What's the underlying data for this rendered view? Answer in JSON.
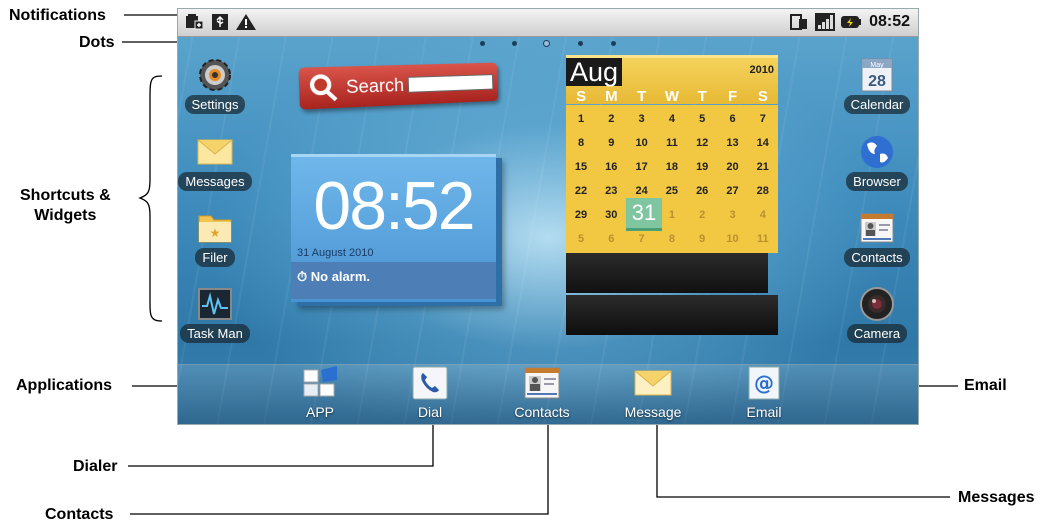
{
  "callouts": {
    "notifications": "Notifications",
    "dots": "Dots",
    "shortcuts_line1": "Shortcuts &",
    "shortcuts_line2": "Widgets",
    "applications": "Applications",
    "dialer": "Dialer",
    "contacts": "Contacts",
    "email": "Email",
    "messages": "Messages"
  },
  "statusbar": {
    "left_icons": [
      "sd-card-icon",
      "usb-icon",
      "warning-icon"
    ],
    "right_icons": [
      "screen-rotate-icon",
      "signal-icon",
      "battery-icon"
    ],
    "time": "08:52"
  },
  "home_dots": 5,
  "left_shortcuts": [
    {
      "label": "Settings",
      "icon": "gear-icon"
    },
    {
      "label": "Messages",
      "icon": "envelope-icon"
    },
    {
      "label": "Filer",
      "icon": "folder-icon"
    },
    {
      "label": "Task Man",
      "icon": "task-manager-icon"
    }
  ],
  "right_shortcuts": [
    {
      "label": "Calendar",
      "icon": "calendar-icon"
    },
    {
      "label": "Browser",
      "icon": "globe-icon"
    },
    {
      "label": "Contacts",
      "icon": "contact-card-icon"
    },
    {
      "label": "Camera",
      "icon": "camera-lens-icon"
    }
  ],
  "search_widget": {
    "label": "Search"
  },
  "clock_widget": {
    "time": "08:52",
    "date": "31 August 2010",
    "alarm": "No alarm."
  },
  "calendar_widget": {
    "month": "Aug",
    "year": "2010",
    "weekdays": [
      "S",
      "M",
      "T",
      "W",
      "T",
      "F",
      "S"
    ],
    "weeks": [
      [
        "1",
        "2",
        "3",
        "4",
        "5",
        "6",
        "7"
      ],
      [
        "8",
        "9",
        "10",
        "11",
        "12",
        "13",
        "14"
      ],
      [
        "15",
        "16",
        "17",
        "18",
        "19",
        "20",
        "21"
      ],
      [
        "22",
        "23",
        "24",
        "25",
        "26",
        "27",
        "28"
      ],
      [
        "29",
        "30",
        "31",
        "1",
        "2",
        "3",
        "4"
      ],
      [
        "5",
        "6",
        "7",
        "8",
        "9",
        "10",
        "11"
      ]
    ],
    "today": "31",
    "calendar_icon_month": "May",
    "calendar_icon_day": "28"
  },
  "dock": [
    {
      "label": "APP",
      "icon": "app-grid-icon"
    },
    {
      "label": "Dial",
      "icon": "phone-icon"
    },
    {
      "label": "Contacts",
      "icon": "contact-card-icon"
    },
    {
      "label": "Message",
      "icon": "envelope-icon"
    },
    {
      "label": "Email",
      "icon": "at-sign-icon"
    }
  ],
  "colors": {
    "screen_top": "#5ea7cf",
    "screen_bottom": "#2f78a8",
    "clock_widget": "#5aa3e0",
    "calendar_yellow": "#f2c843",
    "search_red": "#c0392b"
  }
}
